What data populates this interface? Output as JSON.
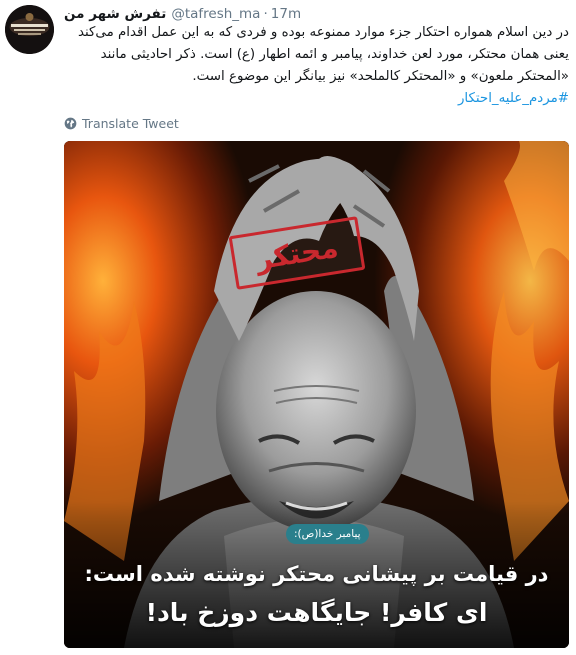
{
  "tweet": {
    "display_name": "تفرش شهر من",
    "handle": "@tafresh_ma",
    "separator": "·",
    "time": "17m",
    "text_lines": [
      "در دین اسلام  همواره احتکار جزء موارد ممنوعه بوده و فردی که به این عمل اقدام می‌کند",
      "یعنی همان محتکر، مورد لعن خداوند، پیامبر و ائمه اطهار (ع) است. ذکر احادیثی مانند",
      "«المحتکر ملعون» و «المحتکر کالملحد» نیز بیانگر این موضوع است."
    ],
    "hashtag": "#مردم_علیه_احتکار",
    "translate_label": "Translate Tweet",
    "translate_icon": "globe-icon"
  },
  "media": {
    "stamp_text": "محتکر",
    "source_tag": "پیامبر خدا(ص):",
    "caption_line1": "در قیامت بر پیشانی محتکر نوشته شده است:",
    "caption_line2": "ای کافر! جایگاهت دوزخ باد!"
  },
  "colors": {
    "link": "#1b95e0",
    "muted": "#657786",
    "text": "#14171a",
    "stamp_red": "#c9282e",
    "tag_teal": "#2a7f8c",
    "fire_orange": "#e8560f"
  }
}
